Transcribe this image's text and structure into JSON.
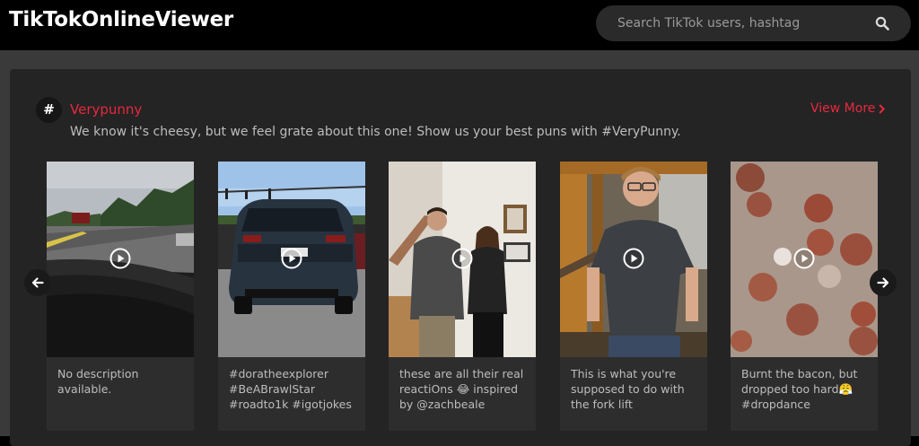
{
  "app": {
    "logo": "TikTokOnlineViewer"
  },
  "search": {
    "placeholder": "Search TikTok users, hashtag"
  },
  "hashtag": {
    "symbol": "#",
    "title": "Verypunny",
    "description": "We know it's cheesy, but we feel grate about this one! Show us your best puns with #VeryPunny.",
    "view_more": "View More"
  },
  "videos": [
    {
      "caption_lines": [
        "No description",
        "available."
      ]
    },
    {
      "caption_lines": [
        "#doratheexplorer",
        "#BeABrawlStar",
        "#roadto1k #igotjokes"
      ]
    },
    {
      "caption_lines": [
        "these are all their real",
        "reactiOns 😂 inspired",
        "by @zachbeale"
      ]
    },
    {
      "caption_lines": [
        "This is what you're",
        "supposed to do with",
        "the fork lift"
      ]
    },
    {
      "caption_lines": [
        "Burnt the bacon, but",
        "dropped too hard😤",
        "#dropdance"
      ]
    }
  ],
  "colors": {
    "accent": "#e8283d",
    "background": "#000000",
    "panel": "#242424",
    "card": "#2d2d2d"
  },
  "icons": {
    "search": "search-icon",
    "play": "play-icon",
    "prev": "arrow-left-icon",
    "next": "arrow-right-icon",
    "hashtag": "hashtag-icon",
    "view_more": "chevron-right-icon"
  }
}
